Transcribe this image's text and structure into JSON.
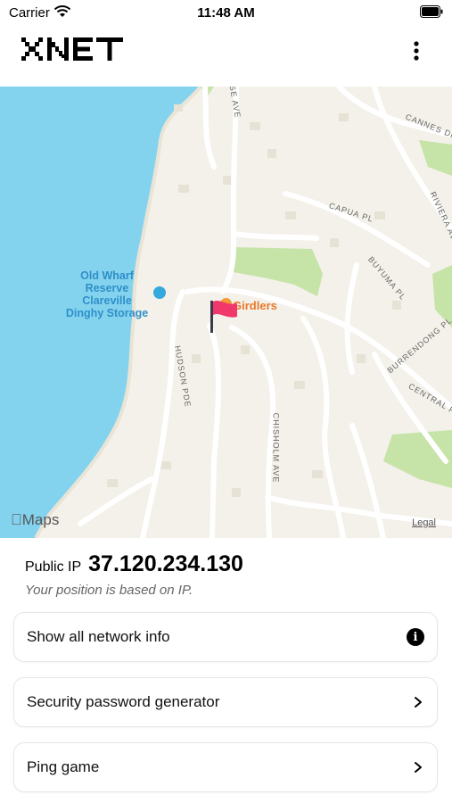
{
  "status_bar": {
    "carrier": "Carrier",
    "time": "11:48 AM"
  },
  "header": {
    "logo_text": "XNET",
    "menu_icon": "more-vertical-icon"
  },
  "map": {
    "poi": "Old Wharf Reserve Clareville Dinghy Storage",
    "poi_lines": [
      "Old Wharf",
      "Reserve",
      "Clareville",
      "Dinghy Storage"
    ],
    "place": "Girdlers",
    "brand": "Maps",
    "legal": "Legal",
    "roads": [
      "CANNES DR",
      "RIVIERA AV",
      "CAPUA PL",
      "BUYUMA PL",
      "BURRENDONG PL",
      "CENTRAL R",
      "HUDSON PDE",
      "CHISHOLM AVE",
      "SE AVE"
    ]
  },
  "ip_info": {
    "label": "Public IP",
    "value": "37.120.234.130",
    "note": "Your position is based on IP."
  },
  "menu": [
    {
      "label": "Show all network info",
      "icon": "info-icon"
    },
    {
      "label": "Security password generator",
      "icon": "chevron-right-icon"
    },
    {
      "label": "Ping game",
      "icon": "chevron-right-icon"
    }
  ],
  "colors": {
    "water": "#84d3ee",
    "land": "#f4f1ea",
    "park": "#c6e3a8",
    "flag": "#f0386b"
  }
}
